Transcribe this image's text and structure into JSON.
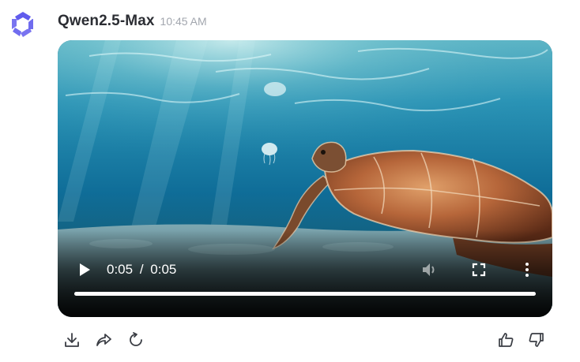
{
  "header": {
    "model_name": "Qwen2.5-Max",
    "timestamp": "10:45 AM",
    "avatar_icon": "qwen-logo-icon",
    "avatar_color": "#615ced"
  },
  "video": {
    "current_time": "0:05",
    "separator": "/",
    "duration": "0:05",
    "progress": 1.0,
    "icons": {
      "play": "play-icon",
      "volume": "volume-icon",
      "fullscreen": "fullscreen-icon",
      "more": "more-vertical-icon"
    }
  },
  "actions": {
    "left": [
      "download-icon",
      "share-icon",
      "regenerate-icon"
    ],
    "right": [
      "thumbs-up-icon",
      "thumbs-down-icon"
    ]
  }
}
